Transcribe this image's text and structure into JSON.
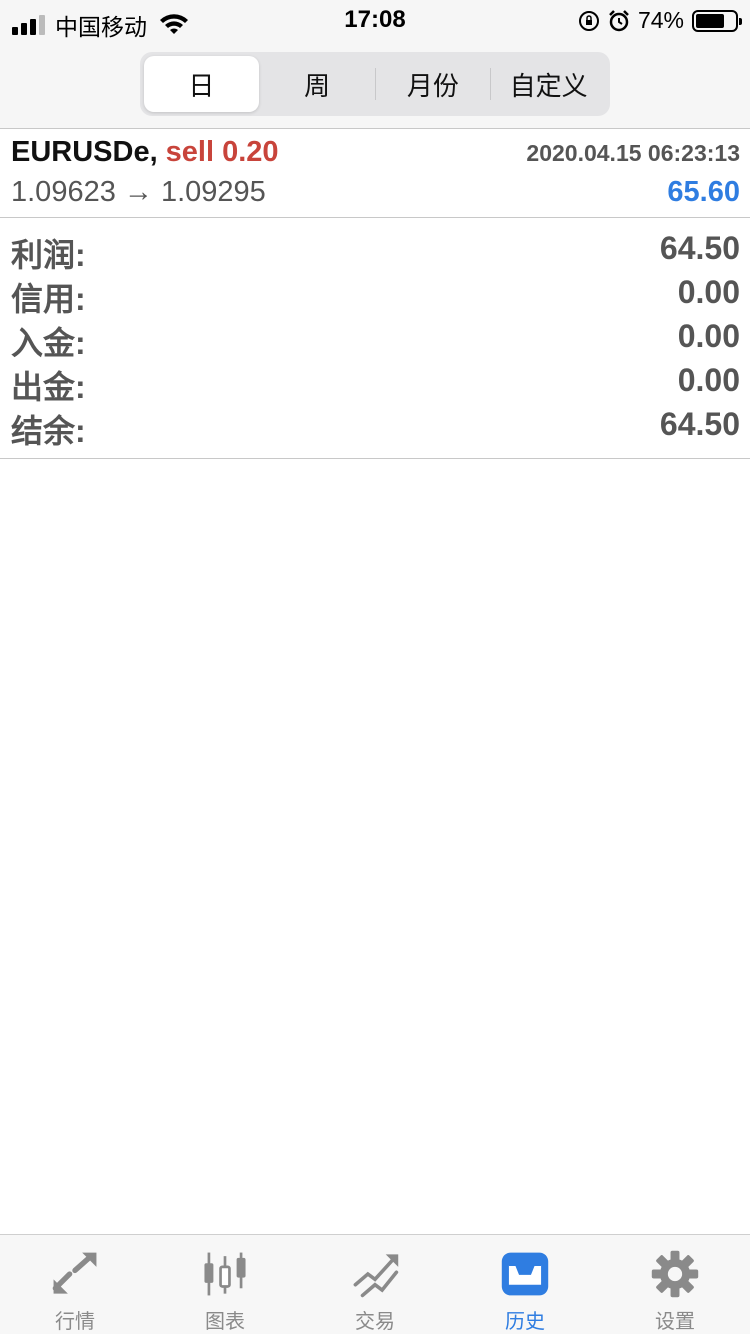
{
  "status_bar": {
    "carrier": "中国移动",
    "time": "17:08",
    "battery_pct": "74%",
    "battery_level": 0.74
  },
  "segments": [
    {
      "label": "日",
      "active": true
    },
    {
      "label": "周",
      "active": false
    },
    {
      "label": "月份",
      "active": false
    },
    {
      "label": "自定义",
      "active": false
    }
  ],
  "trade": {
    "symbol": "EURUSDe,",
    "side": "sell 0.20",
    "datetime": "2020.04.15 06:23:13",
    "prices": "1.09623 → 1.09295",
    "profit": "65.60"
  },
  "summary": [
    {
      "label": "利润:",
      "value": "64.50"
    },
    {
      "label": "信用:",
      "value": "0.00"
    },
    {
      "label": "入金:",
      "value": "0.00"
    },
    {
      "label": "出金:",
      "value": "0.00"
    },
    {
      "label": "结余:",
      "value": "64.50"
    }
  ],
  "tabs": [
    {
      "label": "行情",
      "icon": "quotes-icon",
      "active": false
    },
    {
      "label": "图表",
      "icon": "chart-icon",
      "active": false
    },
    {
      "label": "交易",
      "icon": "trade-icon",
      "active": false
    },
    {
      "label": "历史",
      "icon": "history-icon",
      "active": true
    },
    {
      "label": "设置",
      "icon": "settings-icon",
      "active": false
    }
  ],
  "colors": {
    "accent": "#2f7de1",
    "sell": "#c8443b",
    "tab_inactive": "#8a8a8a"
  }
}
